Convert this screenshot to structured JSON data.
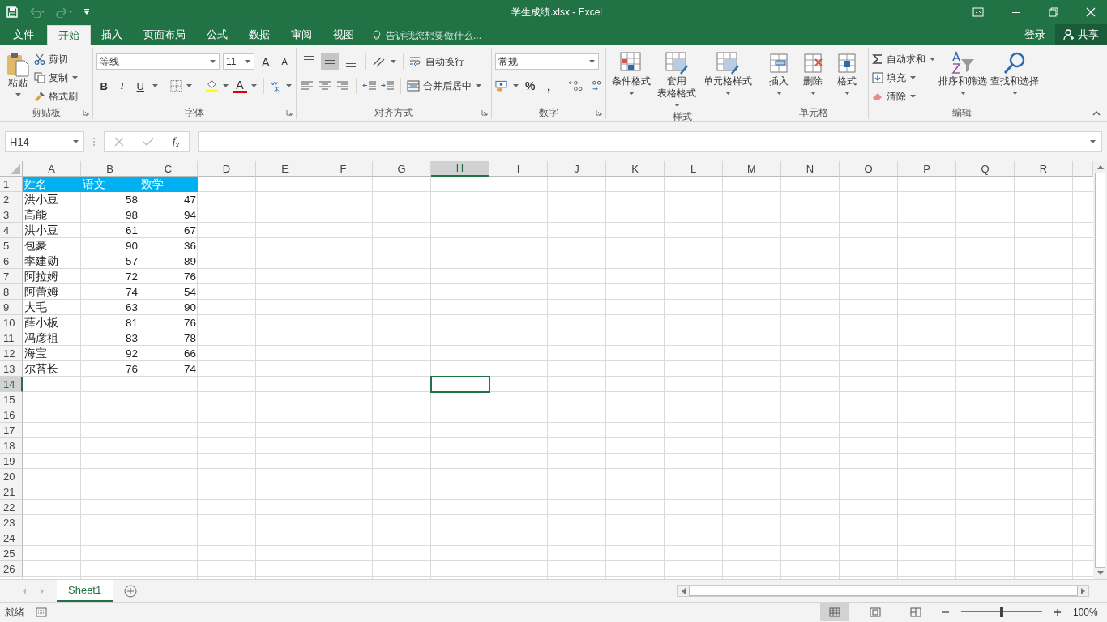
{
  "window": {
    "title": "学生成绩.xlsx - Excel"
  },
  "menu_tabs": [
    {
      "label": "文件",
      "selected": false
    },
    {
      "label": "开始",
      "selected": true
    },
    {
      "label": "插入",
      "selected": false
    },
    {
      "label": "页面布局",
      "selected": false
    },
    {
      "label": "公式",
      "selected": false
    },
    {
      "label": "数据",
      "selected": false
    },
    {
      "label": "审阅",
      "selected": false
    },
    {
      "label": "视图",
      "selected": false
    }
  ],
  "tell_me": {
    "placeholder": "告诉我您想要做什么..."
  },
  "account": {
    "sign_in": "登录",
    "share": "共享"
  },
  "ribbon": {
    "clipboard": {
      "name": "剪贴板",
      "paste": "粘贴",
      "cut": "剪切",
      "copy": "复制",
      "format_painter": "格式刷"
    },
    "font": {
      "name": "字体",
      "font_name": "等线",
      "font_size": "11",
      "grow": "A",
      "shrink": "A",
      "bold": "B",
      "italic": "I",
      "underline": "U",
      "font_color": "A"
    },
    "alignment": {
      "name": "对齐方式",
      "vertical_align": [
        {
          "selected": false
        },
        {
          "selected": true
        },
        {
          "selected": false
        }
      ],
      "wrap": "自动换行",
      "merge": "合并后居中"
    },
    "number": {
      "name": "数字",
      "format": "常规",
      "percent": "%",
      "comma": ","
    },
    "styles": {
      "name": "样式",
      "buttons": [
        [
          "条件格式"
        ],
        [
          "套用",
          "表格格式"
        ],
        [
          "单元格样式"
        ]
      ]
    },
    "cells": {
      "name": "单元格",
      "buttons": [
        "插入",
        "删除",
        "格式"
      ]
    },
    "editing": {
      "name": "编辑",
      "autosum": "自动求和",
      "fill": "填充",
      "clear": "清除",
      "sort": "排序和筛选",
      "find": "查找和选择"
    }
  },
  "formula_bar": {
    "name_box": "H14",
    "fx": "f$_{x}$"
  },
  "sheet": {
    "columns": [
      {
        "label": "A",
        "selected": false
      },
      {
        "label": "B",
        "selected": false
      },
      {
        "label": "C",
        "selected": false
      },
      {
        "label": "D",
        "selected": false
      },
      {
        "label": "E",
        "selected": false
      },
      {
        "label": "F",
        "selected": false
      },
      {
        "label": "G",
        "selected": false
      },
      {
        "label": "H",
        "selected": true
      },
      {
        "label": "I",
        "selected": false
      },
      {
        "label": "J",
        "selected": false
      },
      {
        "label": "K",
        "selected": false
      },
      {
        "label": "L",
        "selected": false
      },
      {
        "label": "M",
        "selected": false
      },
      {
        "label": "N",
        "selected": false
      },
      {
        "label": "O",
        "selected": false
      },
      {
        "label": "P",
        "selected": false
      },
      {
        "label": "Q",
        "selected": false
      },
      {
        "label": "R",
        "selected": false
      }
    ],
    "row_numbers": [
      {
        "label": "1",
        "selected": false
      },
      {
        "label": "2",
        "selected": false
      },
      {
        "label": "3",
        "selected": false
      },
      {
        "label": "4",
        "selected": false
      },
      {
        "label": "5",
        "selected": false
      },
      {
        "label": "6",
        "selected": false
      },
      {
        "label": "7",
        "selected": false
      },
      {
        "label": "8",
        "selected": false
      },
      {
        "label": "9",
        "selected": false
      },
      {
        "label": "10",
        "selected": false
      },
      {
        "label": "11",
        "selected": false
      },
      {
        "label": "12",
        "selected": false
      },
      {
        "label": "13",
        "selected": false
      },
      {
        "label": "14",
        "selected": true
      },
      {
        "label": "15",
        "selected": false
      },
      {
        "label": "16",
        "selected": false
      },
      {
        "label": "17",
        "selected": false
      },
      {
        "label": "18",
        "selected": false
      },
      {
        "label": "19",
        "selected": false
      },
      {
        "label": "20",
        "selected": false
      },
      {
        "label": "21",
        "selected": false
      },
      {
        "label": "22",
        "selected": false
      },
      {
        "label": "23",
        "selected": false
      },
      {
        "label": "24",
        "selected": false
      },
      {
        "label": "25",
        "selected": false
      },
      {
        "label": "26",
        "selected": false
      }
    ],
    "header": [
      "姓名",
      "语文",
      "数学"
    ],
    "rows": [
      [
        "洪小豆",
        "58",
        "47"
      ],
      [
        "高能",
        "98",
        "94"
      ],
      [
        "洪小豆",
        "61",
        "67"
      ],
      [
        "包豪",
        "90",
        "36"
      ],
      [
        "李建勋",
        "57",
        "89"
      ],
      [
        "阿拉姆",
        "72",
        "76"
      ],
      [
        "阿蕾姆",
        "74",
        "54"
      ],
      [
        "大毛",
        "63",
        "90"
      ],
      [
        "薛小板",
        "81",
        "76"
      ],
      [
        "冯彦祖",
        "83",
        "78"
      ],
      [
        "海宝",
        "92",
        "66"
      ],
      [
        "尔苔长",
        "76",
        "74"
      ]
    ]
  },
  "sheet_tabs": [
    {
      "label": "Sheet1",
      "selected": true
    }
  ],
  "status_bar": {
    "status": "就绪",
    "views": [
      {
        "selected": true
      },
      {
        "selected": false
      },
      {
        "selected": false
      }
    ],
    "zoom_slider": {
      "level": 0.5
    },
    "zoom": "100%"
  }
}
